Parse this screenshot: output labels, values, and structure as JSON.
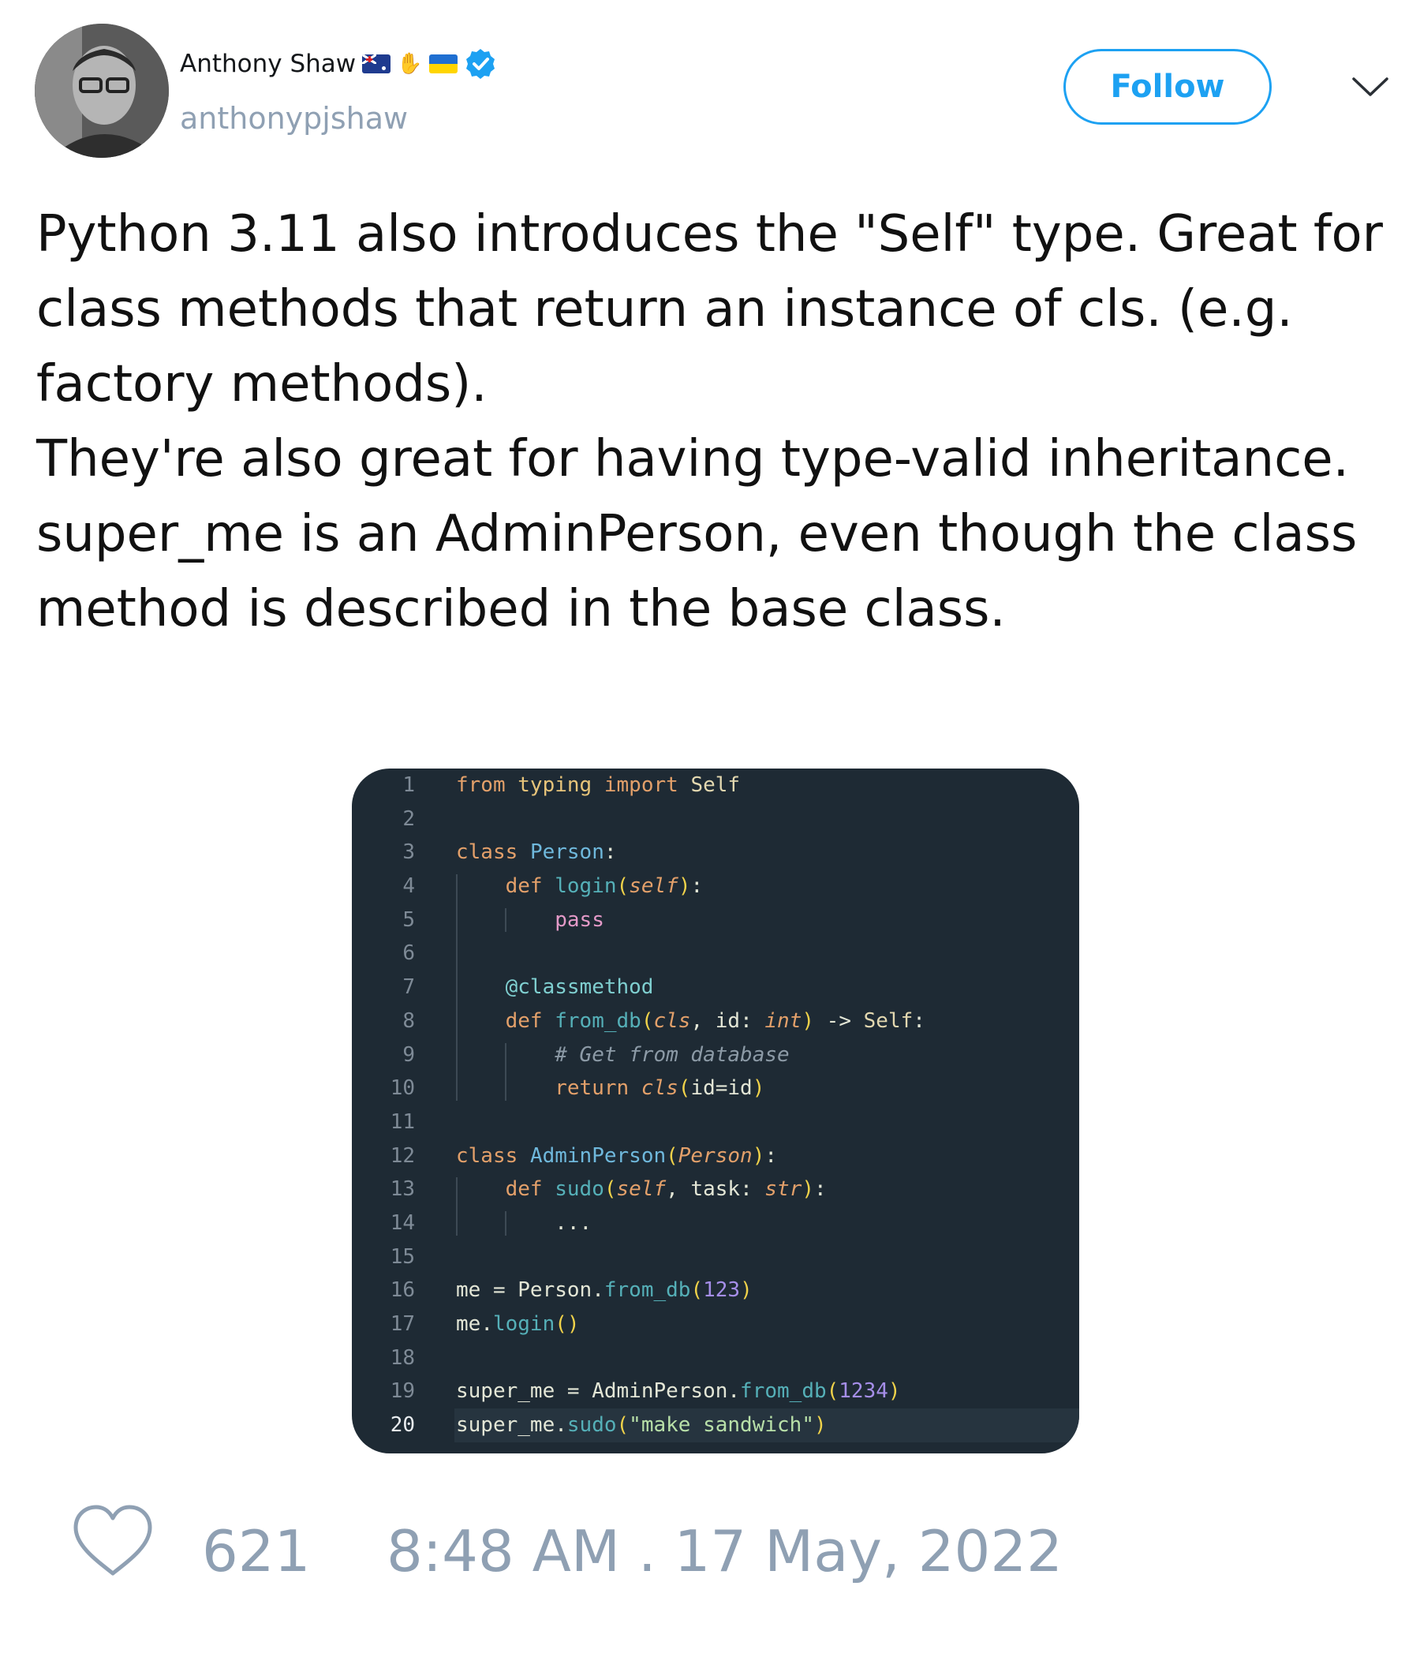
{
  "author": {
    "display_name": "Anthony Shaw",
    "handle": "anthonypjshaw",
    "badges": [
      "australia-flag-icon",
      "handshake-icon",
      "ukraine-flag-icon",
      "verified-icon"
    ]
  },
  "follow_label": "Follow",
  "tweet_text": "Python 3.11 also introduces the \"Self\" type. Great for class methods that return an instance of cls. (e.g. factory methods).\nThey're also great for having type-valid inheritance. super_me is an AdminPerson, even though the class method is described in the base class.",
  "code_image": {
    "line_numbers": [
      "1",
      "2",
      "3",
      "4",
      "5",
      "6",
      "7",
      "8",
      "9",
      "10",
      "11",
      "12",
      "13",
      "14",
      "15",
      "16",
      "17",
      "18",
      "19",
      "20"
    ],
    "lines": [
      "from typing import Self",
      "",
      "class Person:",
      "    def login(self):",
      "        pass",
      "",
      "    @classmethod",
      "    def from_db(cls, id: int) -> Self:",
      "        # Get from database",
      "        return cls(id=id)",
      "",
      "class AdminPerson(Person):",
      "    def sudo(self, task: str):",
      "        ...",
      "",
      "me = Person.from_db(123)",
      "me.login()",
      "",
      "super_me = AdminPerson.from_db(1234)",
      "super_me.sudo(\"make sandwich\")"
    ],
    "active_line": 20
  },
  "footer": {
    "like_count": "621",
    "timestamp": "8:48 AM . 17 May, 2022"
  },
  "colors": {
    "accent": "#1da1f2",
    "muted": "#8fa0b3",
    "code_bg": "#1e2a34"
  }
}
